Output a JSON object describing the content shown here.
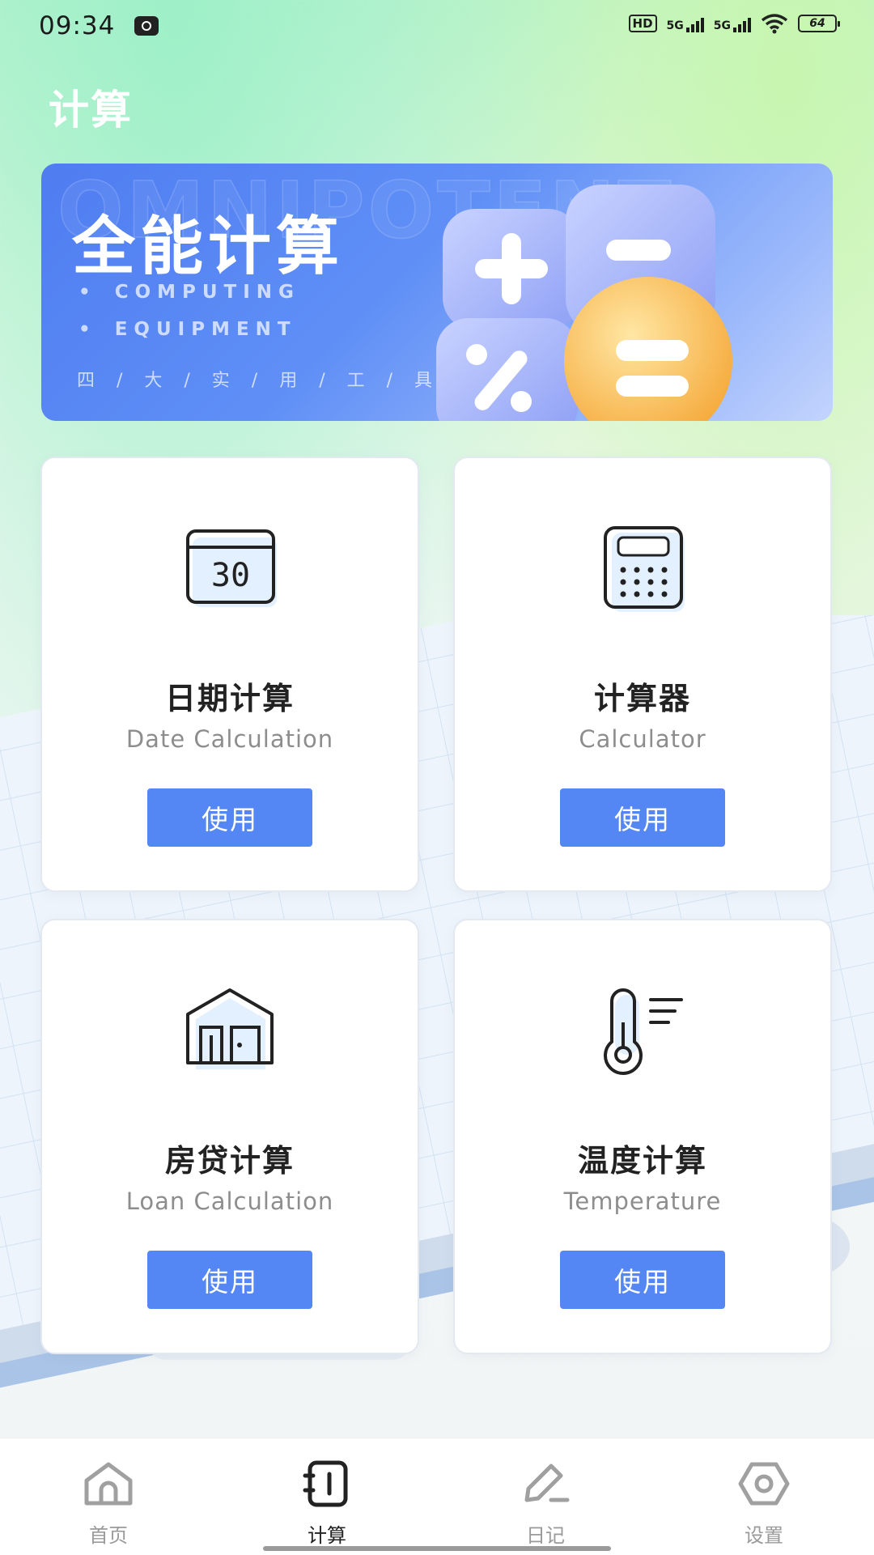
{
  "status_bar": {
    "time": "09:34",
    "net1": "5G",
    "net2": "5G",
    "hd": "HD",
    "battery": "64"
  },
  "page": {
    "title": "计算"
  },
  "banner": {
    "watermark": "OMNIPOTENT",
    "title": "全能计算",
    "sub1": "COMPUTING",
    "sub2": "EQUIPMENT",
    "tags": "四 / 大 / 实 / 用 / 工 / 具"
  },
  "cards": [
    {
      "title": "日期计算",
      "subtitle": "Date Calculation",
      "button": "使用",
      "icon": "calendar-icon"
    },
    {
      "title": "计算器",
      "subtitle": "Calculator",
      "button": "使用",
      "icon": "calculator-icon"
    },
    {
      "title": "房贷计算",
      "subtitle": "Loan Calculation",
      "button": "使用",
      "icon": "house-icon"
    },
    {
      "title": "温度计算",
      "subtitle": "Temperature",
      "button": "使用",
      "icon": "thermometer-icon"
    }
  ],
  "calendar_icon_text": "30",
  "nav": [
    {
      "label": "首页",
      "icon": "home-icon"
    },
    {
      "label": "计算",
      "icon": "notebook-icon",
      "active": true
    },
    {
      "label": "日记",
      "icon": "pen-icon"
    },
    {
      "label": "设置",
      "icon": "settings-icon"
    }
  ],
  "colors": {
    "accent": "#5587f4",
    "banner_start": "#4f7df1",
    "active_nav": "#222222",
    "inactive_nav": "#9a9a9a"
  }
}
